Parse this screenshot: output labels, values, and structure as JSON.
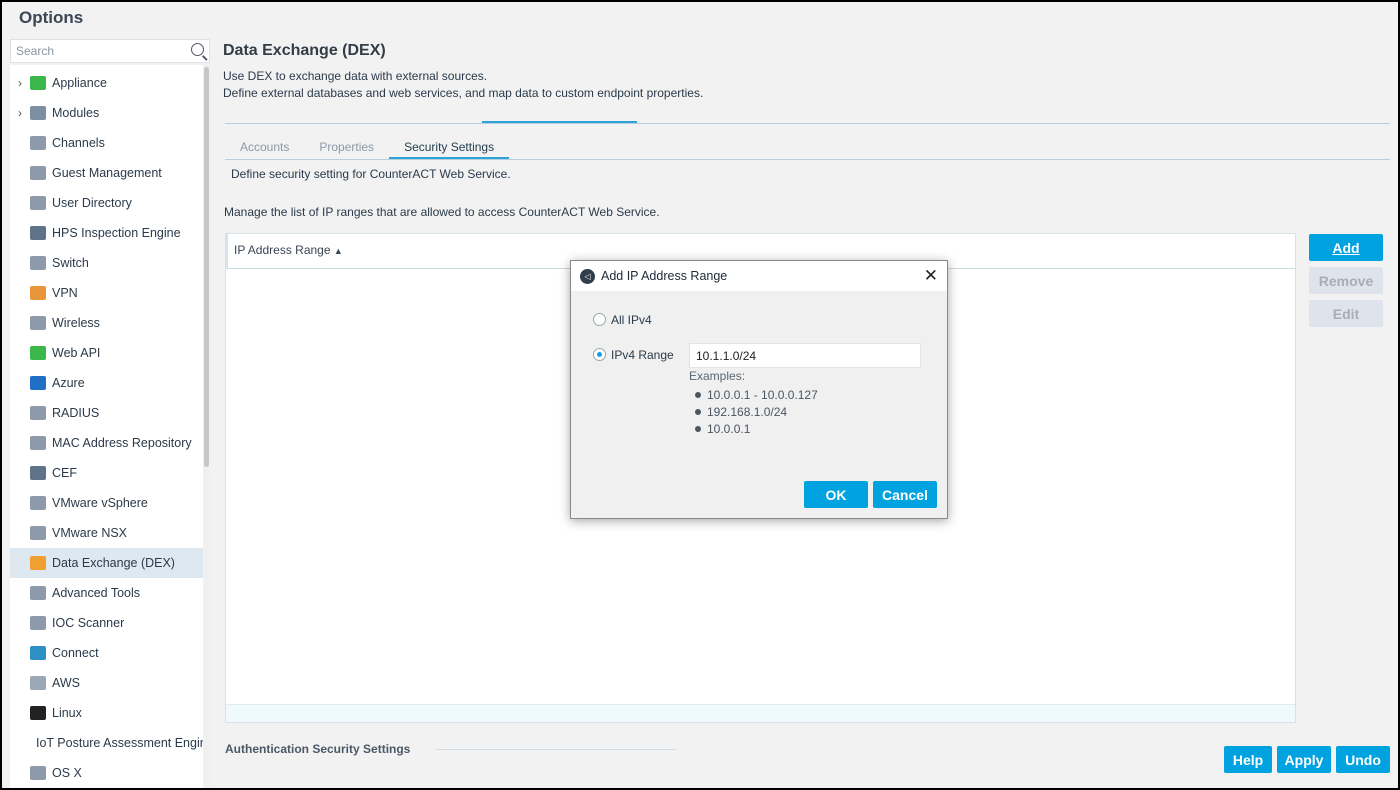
{
  "window": {
    "title": "Options"
  },
  "search": {
    "placeholder": "Search"
  },
  "sidebar": {
    "items": [
      {
        "label": "Appliance",
        "expandable": true,
        "color": "#3cb84a"
      },
      {
        "label": "Modules",
        "expandable": true,
        "color": "#7d8fa3"
      },
      {
        "label": "Channels",
        "color": "#8d9aab"
      },
      {
        "label": "Guest Management",
        "color": "#8d9aab"
      },
      {
        "label": "User Directory",
        "color": "#8d9aab"
      },
      {
        "label": "HPS Inspection Engine",
        "color": "#5f7388"
      },
      {
        "label": "Switch",
        "color": "#8d9aab"
      },
      {
        "label": "VPN",
        "color": "#e9963a"
      },
      {
        "label": "Wireless",
        "color": "#8d9aab"
      },
      {
        "label": "Web API",
        "color": "#3cb84a"
      },
      {
        "label": "Azure",
        "color": "#1f6fc4"
      },
      {
        "label": "RADIUS",
        "color": "#8d9aab"
      },
      {
        "label": "MAC Address Repository",
        "color": "#8d9aab"
      },
      {
        "label": "CEF",
        "color": "#5f7388"
      },
      {
        "label": "VMware vSphere",
        "color": "#8d9aab"
      },
      {
        "label": "VMware NSX",
        "color": "#8d9aab"
      },
      {
        "label": "Data Exchange (DEX)",
        "color": "#f0a030",
        "selected": true
      },
      {
        "label": "Advanced Tools",
        "color": "#8d9aab"
      },
      {
        "label": "IOC Scanner",
        "color": "#8d9aab"
      },
      {
        "label": "Connect",
        "color": "#2e8fc4"
      },
      {
        "label": "AWS",
        "color": "#9aa8b8"
      },
      {
        "label": "Linux",
        "color": "#222222"
      },
      {
        "label": "IoT Posture Assessment Engine",
        "color": "#8d9aab"
      },
      {
        "label": "OS X",
        "color": "#8d9aab"
      }
    ]
  },
  "main": {
    "title": "Data Exchange (DEX)",
    "desc1": "Use DEX to exchange data with external sources.",
    "desc2": "Define external databases and web services, and map data to custom endpoint properties.",
    "tabs": [
      {
        "label": "Accounts"
      },
      {
        "label": "Properties"
      },
      {
        "label": "Security Settings",
        "active": true
      }
    ],
    "tab_desc": "Define security setting for CounterACT Web Service.",
    "list_desc": "Manage the list of IP ranges that are allowed to access CounterACT Web Service.",
    "table": {
      "column": "IP Address Range",
      "sort": "▲"
    },
    "buttons": {
      "add": "Add",
      "remove": "Remove",
      "edit": "Edit"
    },
    "auth_section": "Authentication Security Settings",
    "footer": {
      "help": "Help",
      "apply": "Apply",
      "undo": "Undo"
    }
  },
  "dialog": {
    "title": "Add IP Address Range",
    "close": "✕",
    "opt_all": "All IPv4",
    "opt_range": "IPv4 Range",
    "range_value": "10.1.1.0/24",
    "selected": "range",
    "examples_label": "Examples:",
    "examples": [
      "10.0.0.1 - 10.0.0.127",
      "192.168.1.0/24",
      "10.0.0.1"
    ],
    "ok": "OK",
    "cancel": "Cancel"
  },
  "colors": {
    "accent": "#00a3e0",
    "tab_underline": "#2ea3d6"
  }
}
